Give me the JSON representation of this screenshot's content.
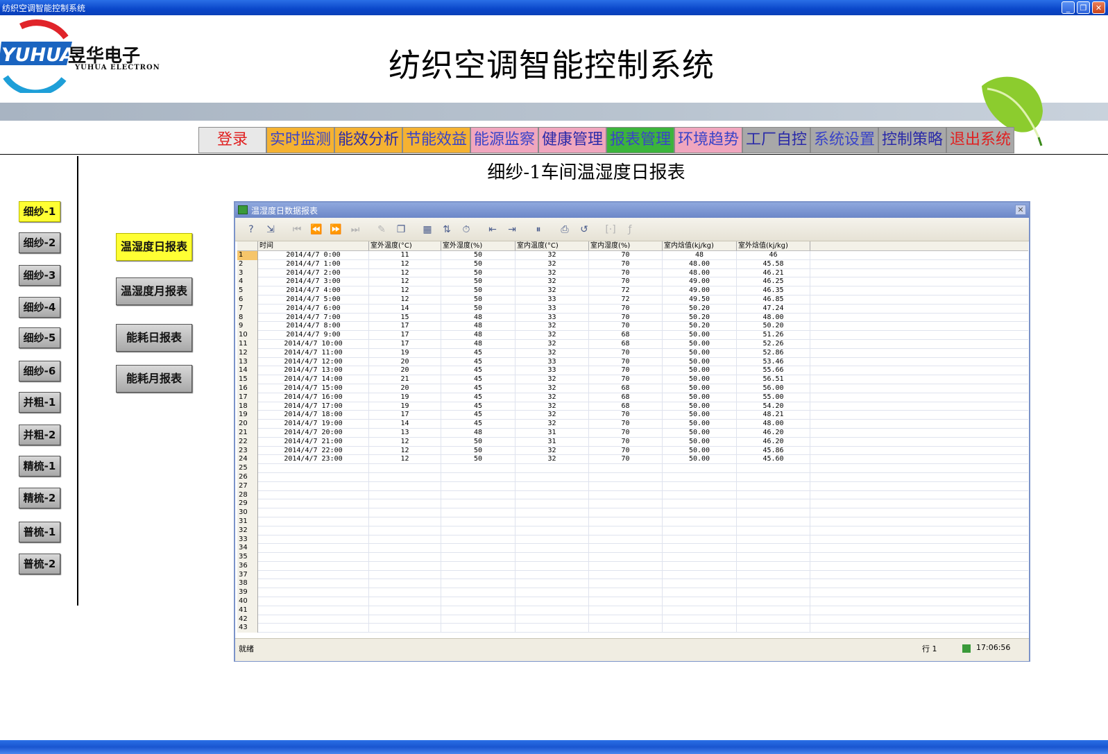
{
  "window": {
    "title": "纺织空调智能控制系统"
  },
  "header": {
    "logo_brand": "YUHUA",
    "logo_cn": "昱华电子",
    "logo_en": "YUHUA ELECTRON",
    "app_title": "纺织空调智能控制系统"
  },
  "nav": {
    "items": [
      {
        "label": "登录",
        "bg": "#e8e8e8",
        "fg": "#e02020"
      },
      {
        "label": "实时监测",
        "bg": "#f5b232",
        "fg": "#3a44c8"
      },
      {
        "label": "能效分析",
        "bg": "#f5b232",
        "fg": "#2a2aa8"
      },
      {
        "label": "节能效益",
        "bg": "#f5b232",
        "fg": "#3a44c8"
      },
      {
        "label": "能源监察",
        "bg": "#f0a6be",
        "fg": "#3a44c8"
      },
      {
        "label": "健康管理",
        "bg": "#f0a6be",
        "fg": "#2a2aa8"
      },
      {
        "label": "报表管理",
        "bg": "#3cb43c",
        "fg": "#3a44c8"
      },
      {
        "label": "环境趋势",
        "bg": "#f0a6be",
        "fg": "#3a44c8"
      },
      {
        "label": "工厂自控",
        "bg": "#a8a8a8",
        "fg": "#2a2aa8"
      },
      {
        "label": "系统设置",
        "bg": "#a8a8a8",
        "fg": "#3a44c8"
      },
      {
        "label": "控制策略",
        "bg": "#a8a8a8",
        "fg": "#2a2aa8"
      },
      {
        "label": "退出系统",
        "bg": "#a8a8a8",
        "fg": "#e02020"
      }
    ]
  },
  "report_title": "细纱-1车间温湿度日报表",
  "side_buttons": [
    "细纱-1",
    "细纱-2",
    "细纱-3",
    "细纱-4",
    "细纱-5",
    "细纱-6",
    "并粗-1",
    "并粗-2",
    "精梳-1",
    "精梳-2",
    "普梳-1",
    "普梳-2"
  ],
  "report_buttons": [
    "温湿度日报表",
    "温湿度月报表",
    "能耗日报表",
    "能耗月报表"
  ],
  "report_window": {
    "title": "温湿度日数据报表",
    "columns": [
      "时间",
      "室外温度(°C)",
      "室外湿度(%)",
      "室内温度(°C)",
      "室内湿度(%)",
      "室内焓值(kj/kg)",
      "室外焓值(kj/kg)"
    ],
    "rows": [
      [
        "2014/4/7 0:00",
        "11",
        "50",
        "32",
        "70",
        "48",
        "46"
      ],
      [
        "2014/4/7 1:00",
        "12",
        "50",
        "32",
        "70",
        "48.00",
        "45.58"
      ],
      [
        "2014/4/7 2:00",
        "12",
        "50",
        "32",
        "70",
        "48.00",
        "46.21"
      ],
      [
        "2014/4/7 3:00",
        "12",
        "50",
        "32",
        "70",
        "49.00",
        "46.25"
      ],
      [
        "2014/4/7 4:00",
        "12",
        "50",
        "32",
        "72",
        "49.00",
        "46.35"
      ],
      [
        "2014/4/7 5:00",
        "12",
        "50",
        "33",
        "72",
        "49.50",
        "46.85"
      ],
      [
        "2014/4/7 6:00",
        "14",
        "50",
        "33",
        "70",
        "50.20",
        "47.24"
      ],
      [
        "2014/4/7 7:00",
        "15",
        "48",
        "33",
        "70",
        "50.20",
        "48.00"
      ],
      [
        "2014/4/7 8:00",
        "17",
        "48",
        "32",
        "70",
        "50.20",
        "50.20"
      ],
      [
        "2014/4/7 9:00",
        "17",
        "48",
        "32",
        "68",
        "50.00",
        "51.26"
      ],
      [
        "2014/4/7 10:00",
        "17",
        "48",
        "32",
        "68",
        "50.00",
        "52.26"
      ],
      [
        "2014/4/7 11:00",
        "19",
        "45",
        "32",
        "70",
        "50.00",
        "52.86"
      ],
      [
        "2014/4/7 12:00",
        "20",
        "45",
        "33",
        "70",
        "50.00",
        "53.46"
      ],
      [
        "2014/4/7 13:00",
        "20",
        "45",
        "33",
        "70",
        "50.00",
        "55.66"
      ],
      [
        "2014/4/7 14:00",
        "21",
        "45",
        "32",
        "70",
        "50.00",
        "56.51"
      ],
      [
        "2014/4/7 15:00",
        "20",
        "45",
        "32",
        "68",
        "50.00",
        "56.00"
      ],
      [
        "2014/4/7 16:00",
        "19",
        "45",
        "32",
        "68",
        "50.00",
        "55.00"
      ],
      [
        "2014/4/7 17:00",
        "19",
        "45",
        "32",
        "68",
        "50.00",
        "54.20"
      ],
      [
        "2014/4/7 18:00",
        "17",
        "45",
        "32",
        "70",
        "50.00",
        "48.21"
      ],
      [
        "2014/4/7 19:00",
        "14",
        "45",
        "32",
        "70",
        "50.00",
        "48.00"
      ],
      [
        "2014/4/7 20:00",
        "13",
        "48",
        "31",
        "70",
        "50.00",
        "46.20"
      ],
      [
        "2014/4/7 21:00",
        "12",
        "50",
        "31",
        "70",
        "50.00",
        "46.20"
      ],
      [
        "2014/4/7 22:00",
        "12",
        "50",
        "32",
        "70",
        "50.00",
        "45.86"
      ],
      [
        "2014/4/7 23:00",
        "12",
        "50",
        "32",
        "70",
        "50.00",
        "45.60"
      ]
    ],
    "total_row_numbers": 43,
    "status_text": "就绪",
    "status_row": "行 1",
    "status_time": "17:06:56"
  },
  "colors": {
    "active_yellow": "#ffff33",
    "title_blue": "#0a46c9"
  }
}
